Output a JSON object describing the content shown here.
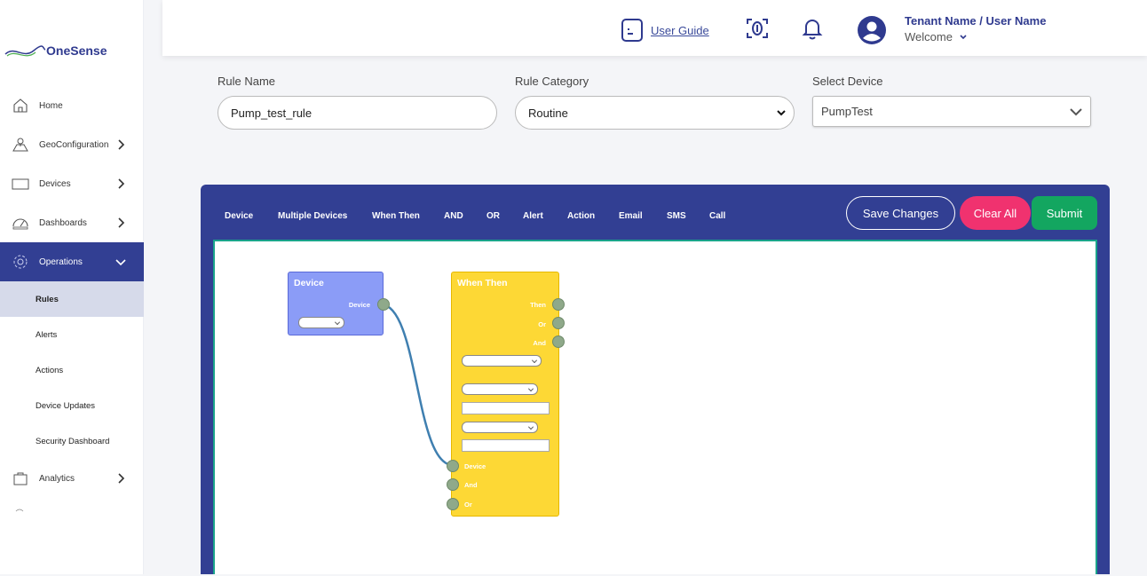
{
  "brand": {
    "name": "OneSense"
  },
  "sidebar": {
    "items": [
      {
        "label": "Home"
      },
      {
        "label": "GeoConfiguration"
      },
      {
        "label": "Devices"
      },
      {
        "label": "Dashboards"
      },
      {
        "label": "Operations"
      },
      {
        "label": "Analytics"
      }
    ],
    "operations_sub": [
      {
        "label": "Rules"
      },
      {
        "label": "Alerts"
      },
      {
        "label": "Actions"
      },
      {
        "label": "Device Updates"
      },
      {
        "label": "Security Dashboard"
      }
    ]
  },
  "header": {
    "user_guide": "User Guide",
    "user_name": "Tenant Name / User Name",
    "welcome": "Welcome"
  },
  "form": {
    "rule_name_label": "Rule Name",
    "rule_name_value": "Pump_test_rule",
    "rule_category_label": "Rule Category",
    "rule_category_value": "Routine",
    "select_device_label": "Select Device",
    "select_device_value": "PumpTest"
  },
  "toolbar": {
    "items": [
      "Device",
      "Multiple Devices",
      "When Then",
      "AND",
      "OR",
      "Alert",
      "Action",
      "Email",
      "SMS",
      "Call"
    ],
    "save": "Save Changes",
    "clear": "Clear All",
    "submit": "Submit"
  },
  "nodes": {
    "device": {
      "title": "Device",
      "port_out": "Device"
    },
    "when_then": {
      "title": "When Then",
      "outputs": [
        "Then",
        "Or",
        "And"
      ],
      "inputs": [
        "Device",
        "And",
        "Or"
      ]
    }
  },
  "colors": {
    "primary": "#323f93",
    "clear": "#f0326f",
    "submit": "#13a660",
    "device_node": "#8b9cf7",
    "when_node": "#fdd835",
    "wire": "#3f7fb0"
  }
}
